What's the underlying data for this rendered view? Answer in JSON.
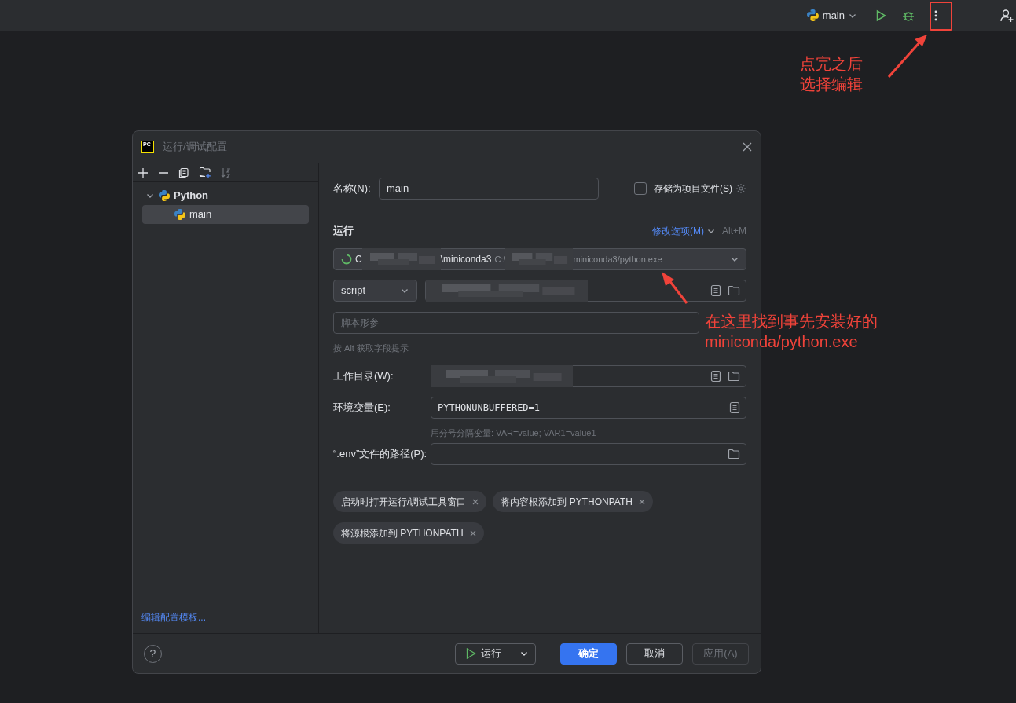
{
  "top_bar": {
    "config": {
      "label": "main"
    }
  },
  "dialog": {
    "logo": "PC",
    "title": "运行/调试配置",
    "tree": [
      {
        "label": "Python",
        "expanded": true,
        "selected": false,
        "children": [
          {
            "label": "main",
            "selected": true
          }
        ]
      }
    ],
    "templates_link": "编辑配置模板...",
    "help": "?",
    "name": {
      "label": "名称(N):",
      "value": "main"
    },
    "store_as_file": {
      "label": "存储为项目文件(S)",
      "checked": false
    },
    "section": "运行",
    "modify_options": {
      "label": "修改选项(M)",
      "shortcut": "Alt+M"
    },
    "interpreter": {
      "name_start": "C",
      "name_end": "\\miniconda3",
      "path_start": "C:/",
      "path_end": "miniconda3/python.exe"
    },
    "script_type": "script",
    "args": {
      "placeholder": "脚本形参"
    },
    "hint": "按 Alt 获取字段提示",
    "working_dir": {
      "label": "工作目录(W):"
    },
    "env": {
      "label": "环境变量(E):",
      "value": "PYTHONUNBUFFERED=1",
      "hint": "用分号分隔变量: VAR=value; VAR1=value1"
    },
    "env_file": {
      "label": "“.env”文件的路径(P):"
    },
    "chips": [
      "启动时打开运行/调试工具窗口",
      "将内容根添加到 PYTHONPATH",
      "将源根添加到 PYTHONPATH"
    ],
    "buttons": [
      {
        "label": "运行",
        "kind": "split",
        "disabled": false
      },
      {
        "label": "确定",
        "kind": "primary",
        "disabled": false
      },
      {
        "label": "取消",
        "kind": "default",
        "disabled": false
      },
      {
        "label": "应用(A)",
        "kind": "default",
        "disabled": true
      }
    ]
  },
  "annotations": [
    {
      "lines": [
        "点完之后",
        "选择编辑"
      ]
    },
    {
      "lines": [
        "在这里找到事先安装好的",
        "miniconda/python.exe"
      ]
    }
  ]
}
